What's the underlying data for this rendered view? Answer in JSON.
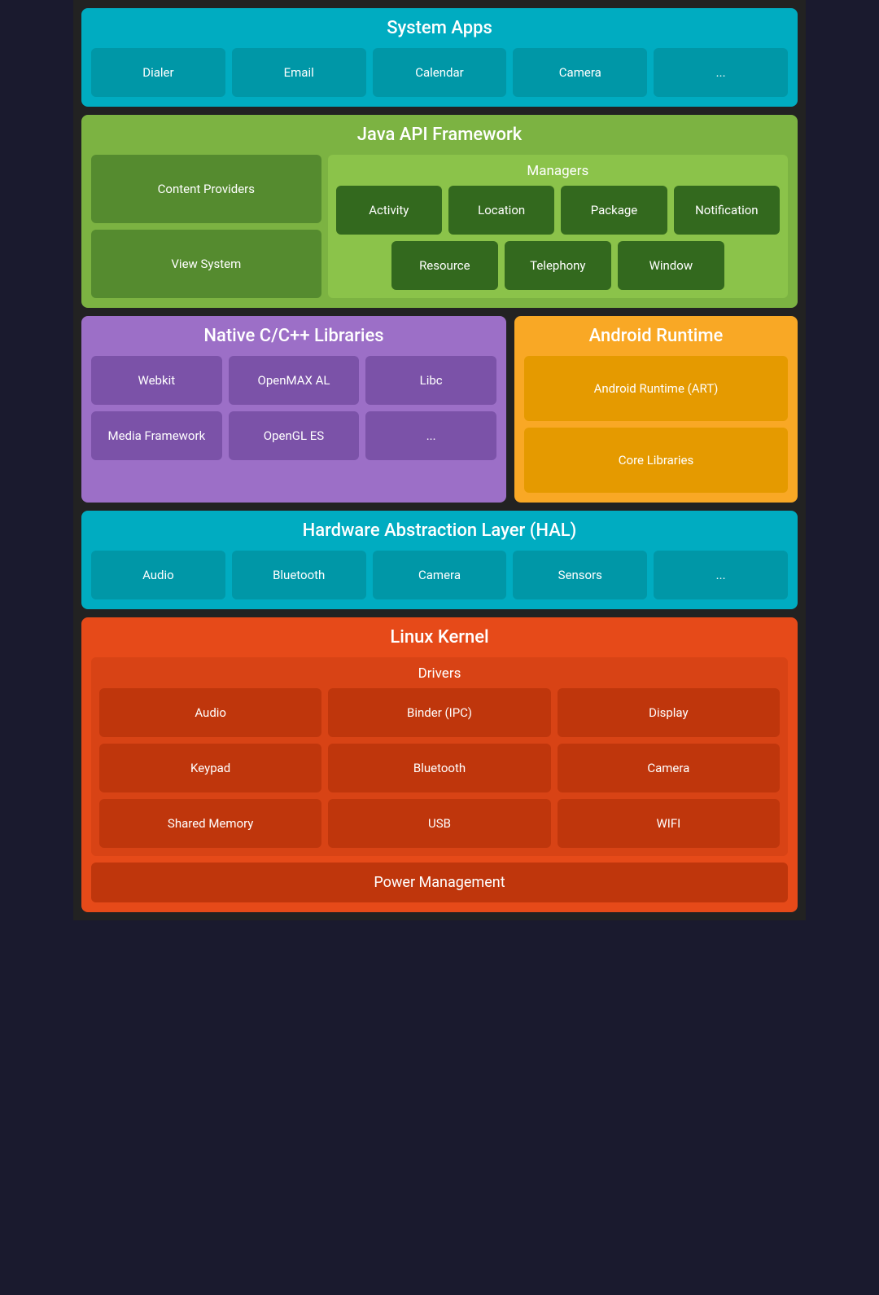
{
  "system_apps": {
    "title": "System Apps",
    "apps": [
      "Dialer",
      "Email",
      "Calendar",
      "Camera",
      "..."
    ]
  },
  "java_api": {
    "title": "Java API Framework",
    "left": [
      "Content Providers",
      "View System"
    ],
    "managers_title": "Managers",
    "managers_row1": [
      "Activity",
      "Location",
      "Package",
      "Notification"
    ],
    "managers_row2": [
      "Resource",
      "Telephony",
      "Window"
    ]
  },
  "native": {
    "title": "Native C/C++ Libraries",
    "row1": [
      "Webkit",
      "OpenMAX AL",
      "Libc"
    ],
    "row2": [
      "Media Framework",
      "OpenGL ES",
      "..."
    ]
  },
  "android_runtime": {
    "title": "Android Runtime",
    "items": [
      "Android Runtime (ART)",
      "Core Libraries"
    ]
  },
  "hal": {
    "title": "Hardware Abstraction Layer (HAL)",
    "items": [
      "Audio",
      "Bluetooth",
      "Camera",
      "Sensors",
      "..."
    ]
  },
  "linux": {
    "title": "Linux Kernel",
    "drivers_title": "Drivers",
    "drivers_row1": [
      "Audio",
      "Binder (IPC)",
      "Display"
    ],
    "drivers_row2": [
      "Keypad",
      "Bluetooth",
      "Camera"
    ],
    "drivers_row3": [
      "Shared Memory",
      "USB",
      "WIFI"
    ],
    "power_management": "Power Management"
  }
}
